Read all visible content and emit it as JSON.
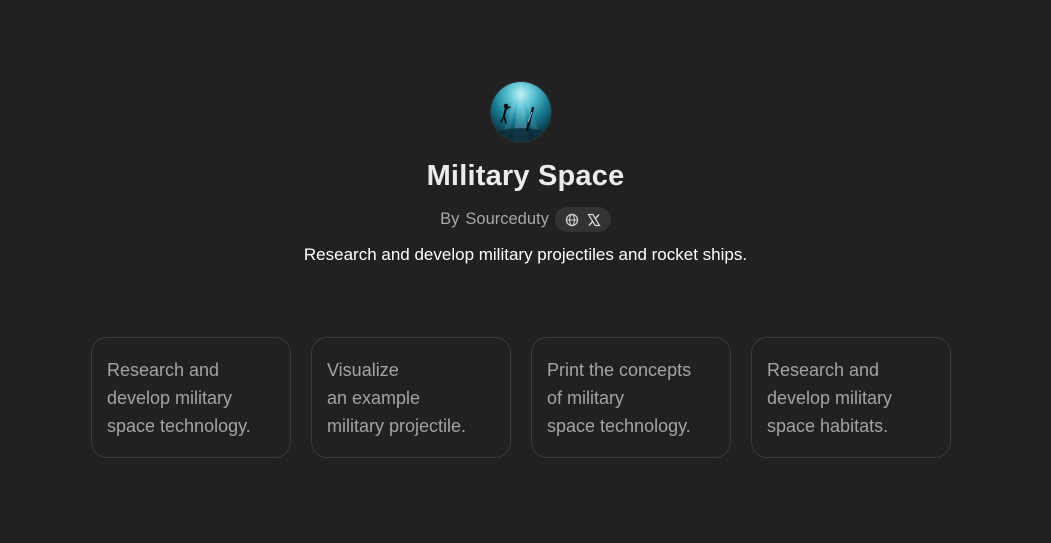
{
  "gpt": {
    "name": "Military Space",
    "by_prefix": "By",
    "author": "Sourceduty",
    "description": "Research and develop military projectiles and rocket ships.",
    "social_icons": [
      "globe-icon",
      "x-logo-icon"
    ]
  },
  "starters": [
    {
      "lines": [
        "Research and",
        "develop military",
        "space technology."
      ]
    },
    {
      "lines": [
        "Visualize",
        "an example",
        "military projectile."
      ]
    },
    {
      "lines": [
        "Print the concepts",
        "of military",
        "space technology."
      ]
    },
    {
      "lines": [
        "Research and",
        "develop military",
        "space habitats."
      ]
    }
  ],
  "colors": {
    "background": "#212121",
    "card_border": "#3a3a3a",
    "pill_bg": "#333333",
    "muted_text": "#a8a8a8"
  }
}
